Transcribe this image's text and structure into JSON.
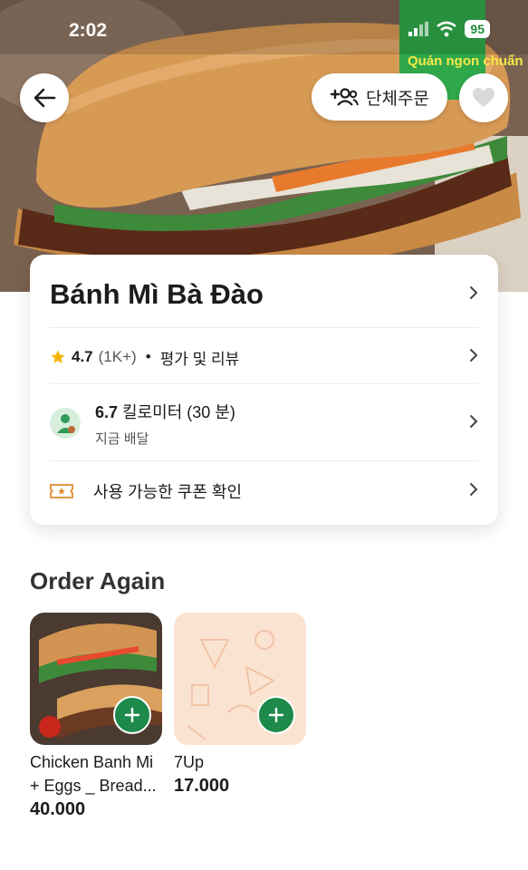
{
  "status_bar": {
    "time": "2:02",
    "battery": "95"
  },
  "header": {
    "group_order_label": "단체주문",
    "hero_badge": "Quán ngon chuẩn"
  },
  "store": {
    "name": "Bánh Mì Bà Đào",
    "rating_value": "4.7",
    "rating_count": "(1K+)",
    "rating_separator": "•",
    "reviews_label": "평가 및 리뷰",
    "distance": "6.7",
    "distance_unit": "킬로미터 (30 분)",
    "delivery_note": "지금 배달",
    "coupon_label": "사용 가능한 쿠폰 확인"
  },
  "order_again": {
    "title": "Order Again",
    "items": [
      {
        "name": "Chicken Banh Mi + Eggs _ Bread...",
        "price": "40.000"
      },
      {
        "name": "7Up",
        "price": "17.000"
      }
    ]
  },
  "icons": [
    "back-arrow-icon",
    "group-add-icon",
    "heart-icon",
    "star-icon",
    "delivery-avatar-icon",
    "coupon-icon",
    "chevron-right-icon",
    "plus-icon",
    "wifi-icon",
    "signal-icon"
  ],
  "colors": {
    "accent": "#1d8a4b",
    "star": "#f5b400",
    "coupon": "#e08a2e"
  }
}
